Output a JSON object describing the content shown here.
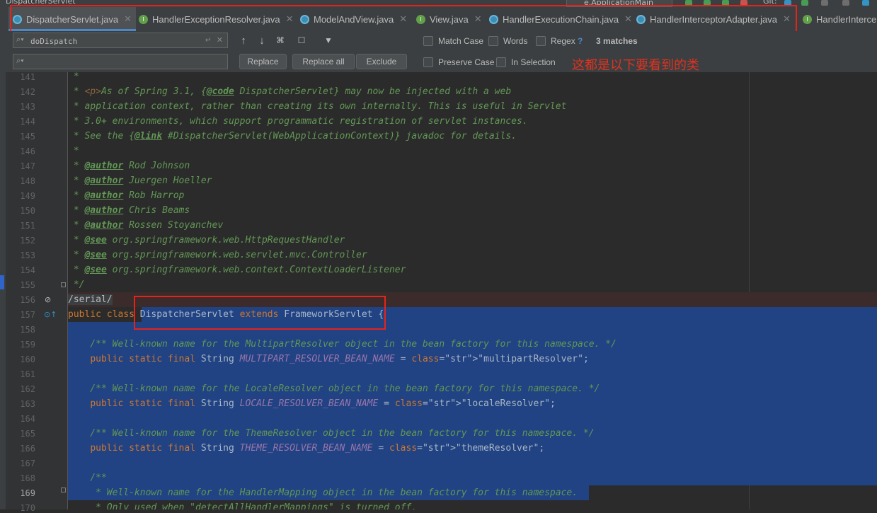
{
  "window": {
    "title": "DispatcherServlet",
    "run_config": "e.ApplicationMain",
    "vcs_label": "Git:"
  },
  "tabs": [
    {
      "label": "DispatcherServlet.java",
      "icon": "class-icon",
      "active": true
    },
    {
      "label": "HandlerExceptionResolver.java",
      "icon": "interface-icon",
      "active": false
    },
    {
      "label": "ModelAndView.java",
      "icon": "class-icon",
      "active": false
    },
    {
      "label": "View.java",
      "icon": "interface-icon",
      "active": false
    },
    {
      "label": "HandlerExecutionChain.java",
      "icon": "class-icon",
      "active": false
    },
    {
      "label": "HandlerInterceptorAdapter.java",
      "icon": "class-icon",
      "active": false
    },
    {
      "label": "HandlerInterce",
      "icon": "interface-icon",
      "active": false
    }
  ],
  "find": {
    "search_value": "doDispatch",
    "replace_value": "",
    "replace_label": "Replace",
    "replace_all_label": "Replace all",
    "exclude_label": "Exclude",
    "match_case_label": "Match Case",
    "words_label": "Words",
    "regex_label": "Regex",
    "help_label": "?",
    "preserve_case_label": "Preserve Case",
    "in_selection_label": "In Selection",
    "matches_text": "3 matches"
  },
  "annotation_text": "这都是以下要看到的类",
  "code_lines": [
    {
      "n": "141",
      "text": " *"
    },
    {
      "n": "142",
      "text": " * <p>As of Spring 3.1, {@code DispatcherServlet} may now be injected with a web"
    },
    {
      "n": "143",
      "text": " * application context, rather than creating its own internally. This is useful in Servlet"
    },
    {
      "n": "144",
      "text": " * 3.0+ environments, which support programmatic registration of servlet instances."
    },
    {
      "n": "145",
      "text": " * See the {@link #DispatcherServlet(WebApplicationContext)} javadoc for details."
    },
    {
      "n": "146",
      "text": " *"
    },
    {
      "n": "147",
      "text": " * @author Rod Johnson"
    },
    {
      "n": "148",
      "text": " * @author Juergen Hoeller"
    },
    {
      "n": "149",
      "text": " * @author Rob Harrop"
    },
    {
      "n": "150",
      "text": " * @author Chris Beams"
    },
    {
      "n": "151",
      "text": " * @author Rossen Stoyanchev"
    },
    {
      "n": "152",
      "text": " * @see org.springframework.web.HttpRequestHandler"
    },
    {
      "n": "153",
      "text": " * @see org.springframework.web.servlet.mvc.Controller"
    },
    {
      "n": "154",
      "text": " * @see org.springframework.web.context.ContextLoaderListener"
    },
    {
      "n": "155",
      "text": " */"
    },
    {
      "n": "156",
      "text": "/serial/"
    },
    {
      "n": "157",
      "text": "public class DispatcherServlet extends FrameworkServlet {"
    },
    {
      "n": "158",
      "text": ""
    },
    {
      "n": "159",
      "text": "    /** Well-known name for the MultipartResolver object in the bean factory for this namespace. */"
    },
    {
      "n": "160",
      "text": "    public static final String MULTIPART_RESOLVER_BEAN_NAME = \"multipartResolver\";"
    },
    {
      "n": "161",
      "text": ""
    },
    {
      "n": "162",
      "text": "    /** Well-known name for the LocaleResolver object in the bean factory for this namespace. */"
    },
    {
      "n": "163",
      "text": "    public static final String LOCALE_RESOLVER_BEAN_NAME = \"localeResolver\";"
    },
    {
      "n": "164",
      "text": ""
    },
    {
      "n": "165",
      "text": "    /** Well-known name for the ThemeResolver object in the bean factory for this namespace. */"
    },
    {
      "n": "166",
      "text": "    public static final String THEME_RESOLVER_BEAN_NAME = \"themeResolver\";"
    },
    {
      "n": "167",
      "text": ""
    },
    {
      "n": "168",
      "text": "    /**"
    },
    {
      "n": "169",
      "text": "     * Well-known name for the HandlerMapping object in the bean factory for this namespace."
    },
    {
      "n": "170",
      "text": "     * Only used when \"detectAllHandlerMappings\" is turned off."
    }
  ],
  "colors": {
    "editor_bg": "#2b2b2b",
    "selection": "#214283",
    "comment": "#629755",
    "keyword": "#cc7832",
    "field": "#9876aa",
    "string": "#6a8759",
    "annotation_red": "#e5231a"
  }
}
